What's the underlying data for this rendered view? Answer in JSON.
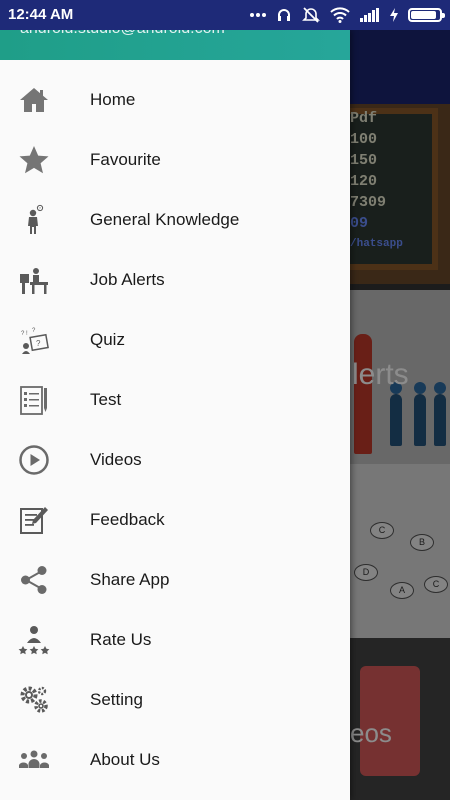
{
  "status_bar": {
    "time": "12:44 AM",
    "icons": [
      "more-dots-icon",
      "headset-icon",
      "dnd-off-icon",
      "wifi-icon",
      "signal-icon",
      "charging-icon",
      "battery-icon"
    ],
    "battery_level": 0.9
  },
  "drawer": {
    "account_email": "android.studio@android.com",
    "items": [
      {
        "label": "Home",
        "icon": "home-icon"
      },
      {
        "label": "Favourite",
        "icon": "star-icon"
      },
      {
        "label": "General Knowledge",
        "icon": "thinking-person-icon"
      },
      {
        "label": "Job Alerts",
        "icon": "desk-worker-icon"
      },
      {
        "label": "Quiz",
        "icon": "quiz-board-icon"
      },
      {
        "label": "Test",
        "icon": "test-sheet-icon"
      },
      {
        "label": "Videos",
        "icon": "play-circle-icon"
      },
      {
        "label": "Feedback",
        "icon": "feedback-form-icon"
      },
      {
        "label": "Share App",
        "icon": "share-icon"
      },
      {
        "label": "Rate Us",
        "icon": "rate-person-stars-icon"
      },
      {
        "label": "Setting",
        "icon": "gears-icon"
      },
      {
        "label": "About Us",
        "icon": "group-icon"
      }
    ]
  },
  "background": {
    "board_lines": [
      "Pdf",
      "100",
      "150",
      "120",
      "7309",
      "09"
    ],
    "board_footer": "/hatsapp",
    "job_card_text": "lerts",
    "bubble_letters": [
      "C",
      "B",
      "D",
      "A",
      "C"
    ],
    "video_card_text": "eos"
  },
  "colors": {
    "status_bar": "#1e2a78",
    "drawer_header": "#26a69a",
    "drawer_bg": "#fafafa",
    "icon": "#757575",
    "text": "#1a1a1a"
  }
}
